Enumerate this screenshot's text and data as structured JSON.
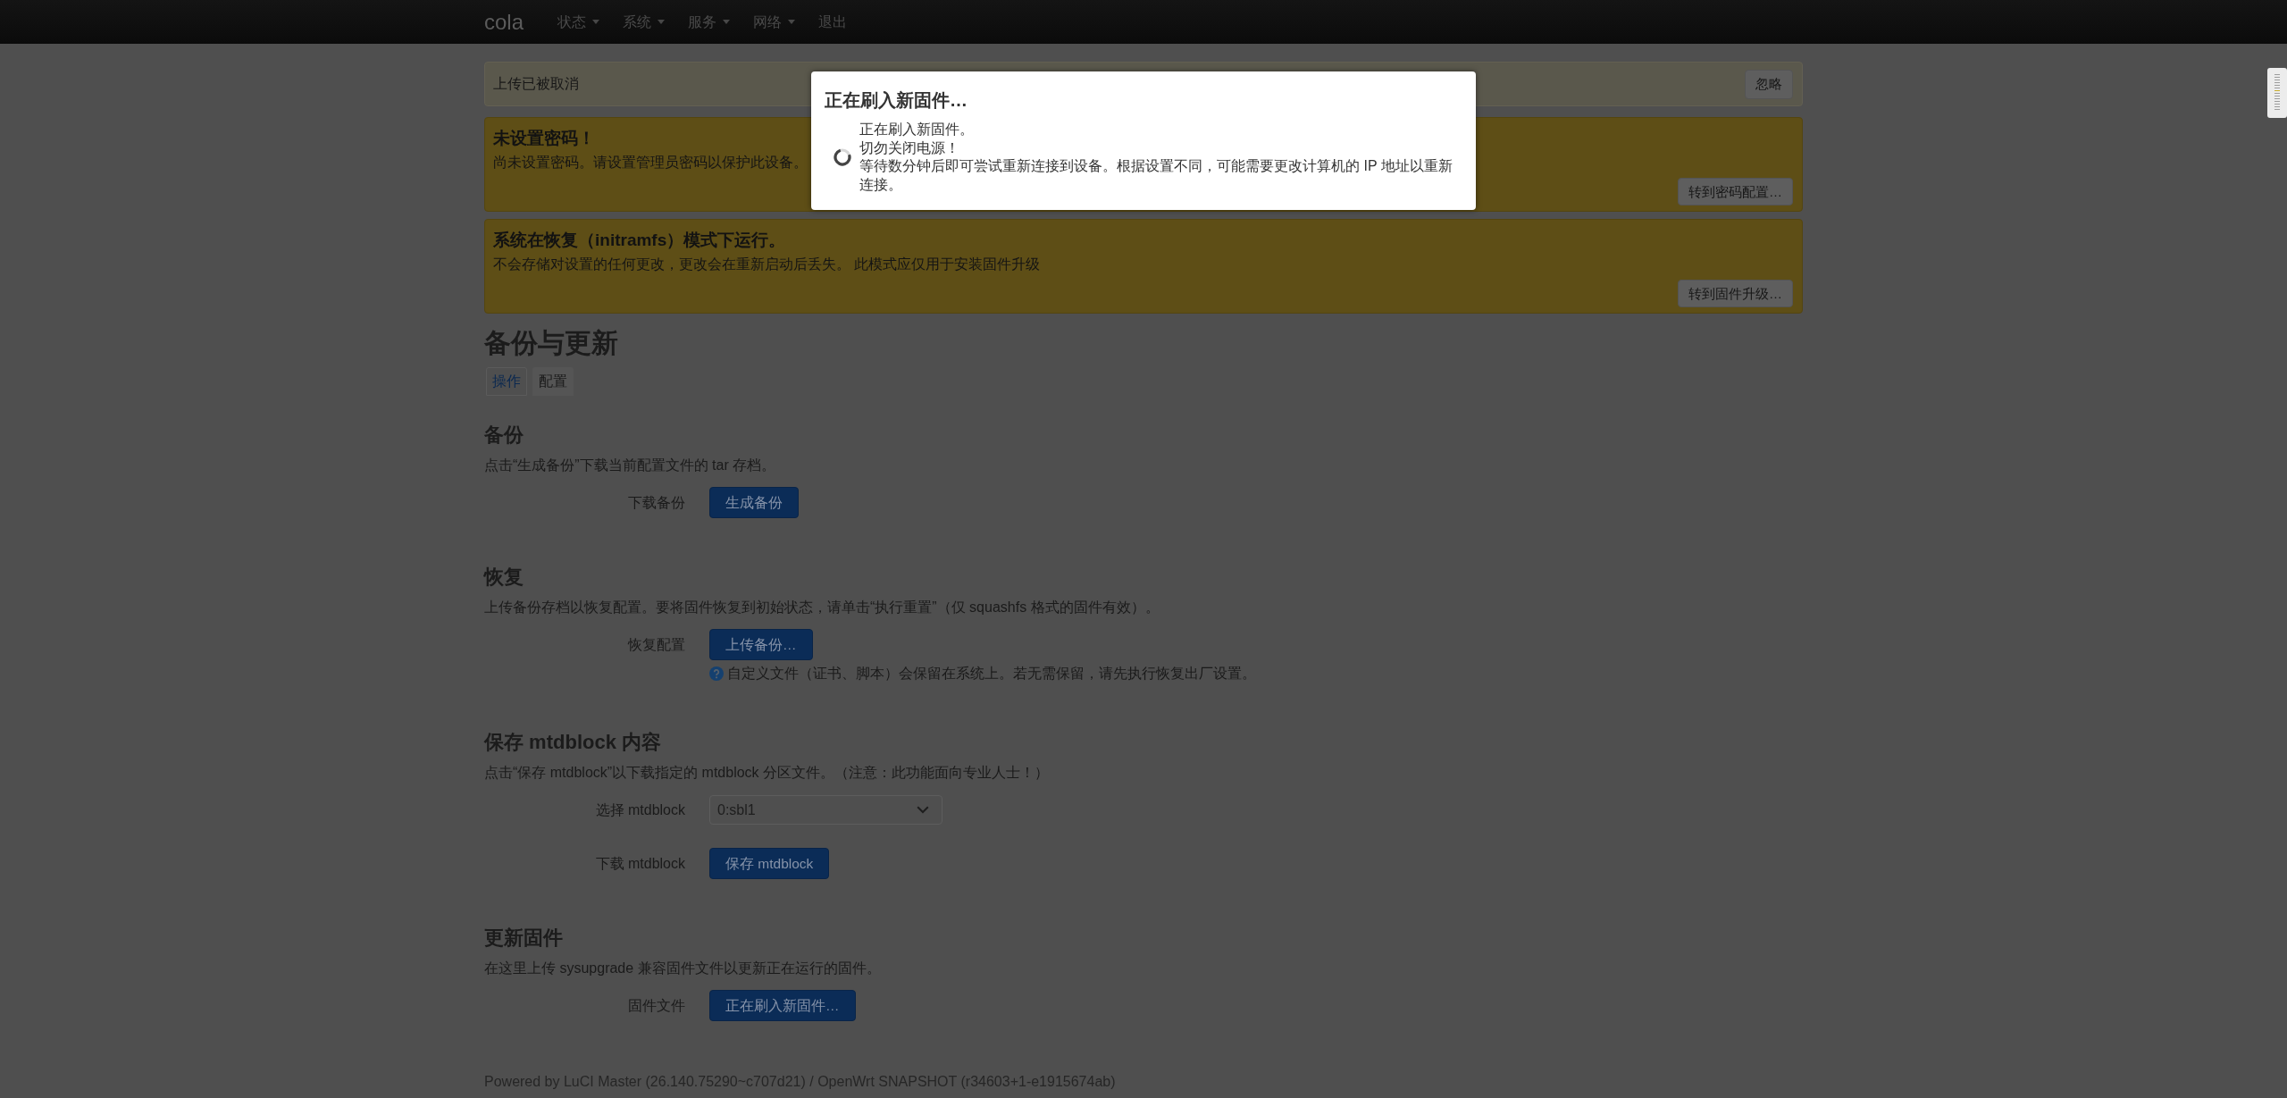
{
  "navbar": {
    "brand": "cola",
    "menu": [
      {
        "label": "状态",
        "dropdown": true
      },
      {
        "label": "系统",
        "dropdown": true
      },
      {
        "label": "服务",
        "dropdown": true
      },
      {
        "label": "网络",
        "dropdown": true
      },
      {
        "label": "退出",
        "dropdown": false
      }
    ]
  },
  "notifications": [
    {
      "kind": "info",
      "text": "上传已被取消",
      "button": "忽略"
    },
    {
      "kind": "warning",
      "title": "未设置密码！",
      "text": "尚未设置密码。请设置管理员密码以保护此设备。",
      "button": "转到密码配置…"
    },
    {
      "kind": "warning",
      "title": "系统在恢复（initramfs）模式下运行。",
      "text": "不会存储对设置的任何更改，更改会在重新启动后丢失。 此模式应仅用于安装固件升级",
      "button": "转到固件升级…"
    }
  ],
  "page": {
    "title": "备份与更新",
    "tabs": [
      {
        "label": "操作",
        "selected": true
      },
      {
        "label": "配置",
        "selected": false
      }
    ],
    "sections": [
      {
        "title": "备份",
        "description": "点击“生成备份”下载当前配置文件的 tar 存档。",
        "fields": [
          {
            "kind": "button",
            "label": "下载备份",
            "button": "生成备份"
          }
        ]
      },
      {
        "title": "恢复",
        "description": "上传备份存档以恢复配置。要将固件恢复到初始状态，请单击“执行重置”（仅 squashfs 格式的固件有效）。",
        "fields": [
          {
            "kind": "button",
            "label": "恢复配置",
            "button": "上传备份…",
            "help": "自定义文件（证书、脚本）会保留在系统上。若无需保留，请先执行恢复出厂设置。"
          }
        ]
      },
      {
        "title": "保存 mtdblock 内容",
        "description": "点击“保存 mtdblock”以下载指定的 mtdblock 分区文件。（注意：此功能面向专业人士！）",
        "fields": [
          {
            "kind": "select",
            "label": "选择 mtdblock",
            "value": "0:sbl1"
          },
          {
            "kind": "button",
            "label": "下载 mtdblock",
            "button": "保存 mtdblock"
          }
        ]
      },
      {
        "title": "更新固件",
        "description": "在这里上传 sysupgrade 兼容固件文件以更新正在运行的固件。",
        "fields": [
          {
            "kind": "button",
            "label": "固件文件",
            "button": "正在刷入新固件…"
          }
        ]
      }
    ]
  },
  "modal": {
    "title": "正在刷入新固件…",
    "lines": [
      "正在刷入新固件。",
      "切勿关闭电源！",
      "等待数分钟后即可尝试重新连接到设备。根据设置不同，可能需要更改计算机的 IP 地址以重新连接。"
    ]
  },
  "footer": {
    "prefix": "Powered by",
    "links": [
      "LuCI Master (26.140.75290~c707d21)",
      "OpenWrt SNAPSHOT (r34603+1-e1915674ab)"
    ],
    "separator": "/"
  }
}
